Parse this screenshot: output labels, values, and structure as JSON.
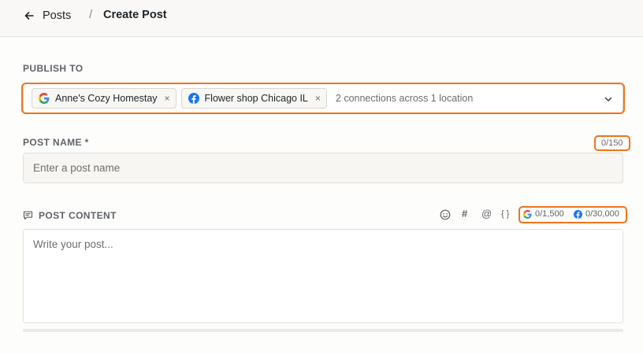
{
  "breadcrumb": {
    "back_label": "Posts",
    "separator": "/",
    "current": "Create Post"
  },
  "publish": {
    "label": "PUBLISH TO",
    "connections": [
      {
        "name": "Anne's Cozy Homestay",
        "icon": "google-icon",
        "remove": "×"
      },
      {
        "name": "Flower shop Chicago IL",
        "icon": "facebook-icon",
        "remove": "×"
      }
    ],
    "summary": "2 connections across 1 location"
  },
  "post_name": {
    "label": "POST NAME *",
    "counter": "0/150",
    "placeholder": "Enter a post name"
  },
  "post_content": {
    "label": "POST CONTENT",
    "toolbar": {
      "emoji_icon": "emoji-icon",
      "hashtag": "#",
      "mention": "@",
      "variable": "{ }"
    },
    "limits": [
      {
        "platform": "google",
        "value": "0/1,500"
      },
      {
        "platform": "facebook",
        "value": "0/30,000"
      }
    ],
    "placeholder": "Write your post..."
  },
  "colors": {
    "highlight": "#f0731f",
    "facebook": "#1877f2",
    "background": "#fdfdfb"
  }
}
